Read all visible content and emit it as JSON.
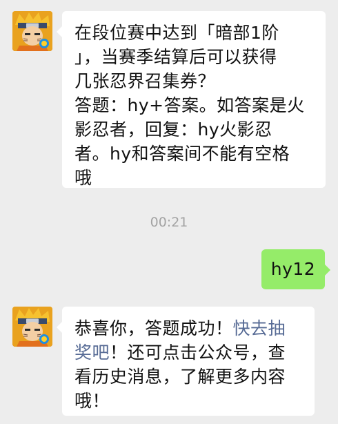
{
  "messages": [
    {
      "sender": "bot",
      "avatar_icon": "naruto-avatar-icon",
      "lines": [
        "在段位赛中达到「暗部1阶",
        "」，当赛季结算后可以获得",
        "几张忍界召集券？",
        "答题：hy+答案。如答案是火",
        "影忍者，回复：hy火影忍",
        "者。hy和答案间不能有空格",
        "哦"
      ]
    },
    {
      "sender": "user",
      "text": "hy12"
    },
    {
      "sender": "bot",
      "avatar_icon": "naruto-avatar-icon",
      "line1_text": "恭喜你，答题成功！",
      "line1_link": "快去抽",
      "line2_link": "奖吧",
      "line2_text": "！还可点击公众号，查",
      "line3": "看历史消息，了解更多内容",
      "line4": "哦！"
    }
  ],
  "timestamp": "00:21",
  "colors": {
    "background": "#ededed",
    "bot_bubble": "#ffffff",
    "user_bubble": "#95ec69",
    "link": "#576b95",
    "timestamp": "#a3a3a3"
  }
}
